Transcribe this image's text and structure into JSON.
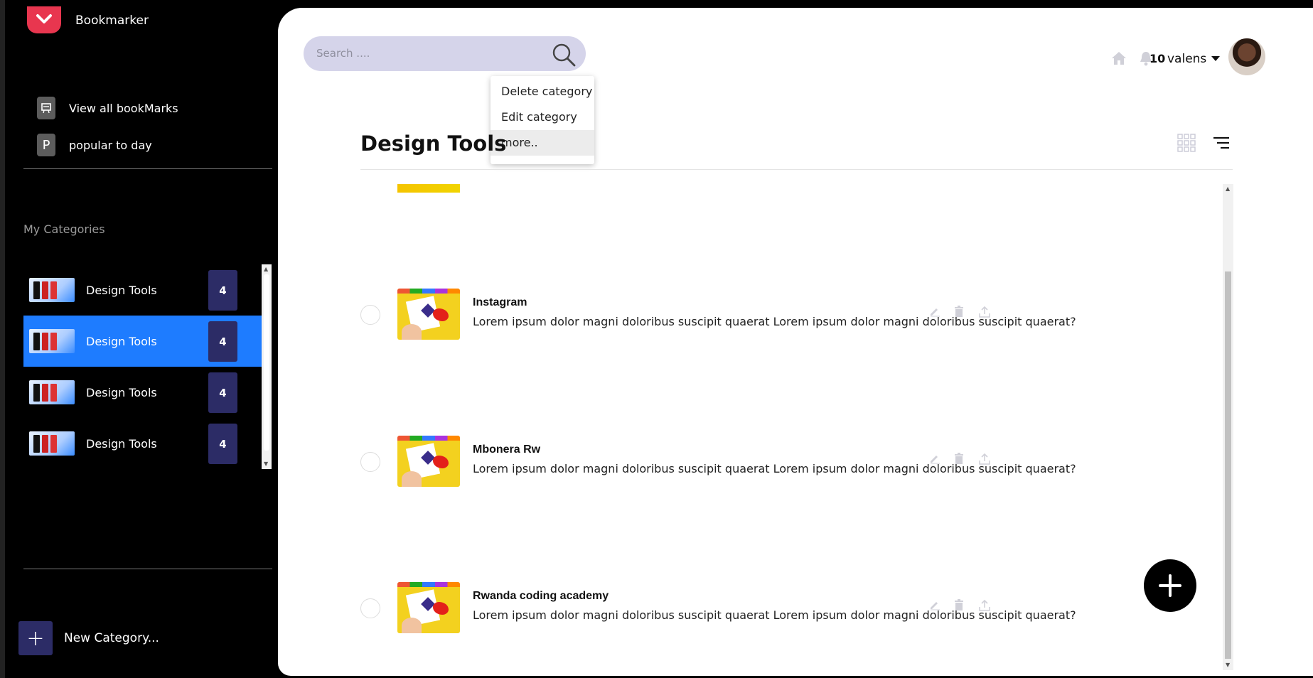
{
  "app": {
    "brand": "Bookmarker"
  },
  "sidebar": {
    "nav": [
      {
        "label": "View all bookMarks",
        "icon": "bookmark-board-icon"
      },
      {
        "label": "popular to day",
        "icon": "p-letter-icon",
        "glyph": "P"
      }
    ],
    "section_label": "My Categories",
    "categories": [
      {
        "label": "Design Tools",
        "count": "4",
        "selected": false
      },
      {
        "label": "Design Tools",
        "count": "4",
        "selected": true
      },
      {
        "label": "Design Tools",
        "count": "4",
        "selected": false
      },
      {
        "label": "Design Tools",
        "count": "4",
        "selected": false
      }
    ],
    "new_category": {
      "icon": "+",
      "label": "New Category..."
    }
  },
  "header": {
    "search": {
      "placeholder": "Search ...."
    },
    "notifications": "10",
    "user": "valens"
  },
  "dropdown": {
    "items": [
      "Delete category",
      "Edit category",
      "more.."
    ]
  },
  "main": {
    "title": "Design Tools",
    "bookmarks": [
      {
        "title": "Instagram",
        "description": "Lorem ipsum dolor magni doloribus suscipit quaerat Lorem ipsum dolor magni doloribus suscipit quaerat?"
      },
      {
        "title": "Mbonera Rw",
        "description": "Lorem ipsum dolor magni doloribus suscipit quaerat Lorem ipsum dolor magni doloribus suscipit quaerat?"
      },
      {
        "title": "Rwanda coding academy",
        "description": "Lorem ipsum dolor magni doloribus suscipit quaerat Lorem ipsum dolor magni doloribus suscipit quaerat?"
      }
    ]
  },
  "colors": {
    "accent": "#1e7cff",
    "badge": "#2c2c66",
    "logo": "#e8364f",
    "search_bg": "#d5d4ea"
  }
}
